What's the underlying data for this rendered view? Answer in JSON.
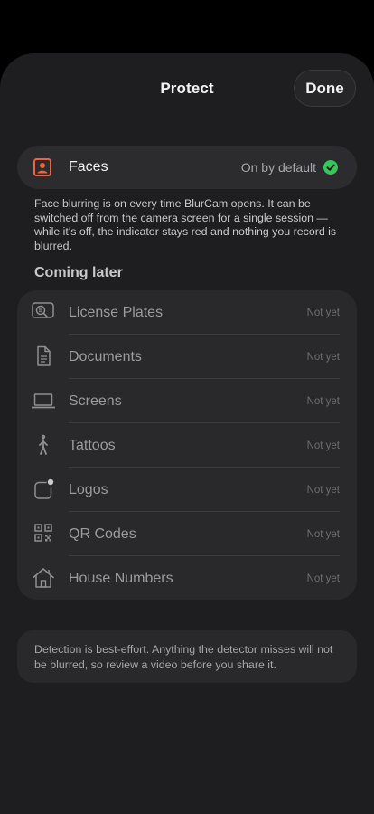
{
  "nav": {
    "title": "Protect",
    "done_label": "Done"
  },
  "faces": {
    "label": "Faces",
    "status": "On by default",
    "description": "Face blurring is on every time BlurCam opens. It can be switched off from the camera screen for a single session — while it's off, the indicator stays red and nothing you record is blurred."
  },
  "coming_later": {
    "heading": "Coming later",
    "items": [
      {
        "label": "License Plates",
        "status": "Not yet",
        "icon": "license-plate-icon"
      },
      {
        "label": "Documents",
        "status": "Not yet",
        "icon": "document-icon"
      },
      {
        "label": "Screens",
        "status": "Not yet",
        "icon": "laptop-icon"
      },
      {
        "label": "Tattoos",
        "status": "Not yet",
        "icon": "person-icon"
      },
      {
        "label": "Logos",
        "status": "Not yet",
        "icon": "app-badge-icon"
      },
      {
        "label": "QR Codes",
        "status": "Not yet",
        "icon": "qr-code-icon"
      },
      {
        "label": "House Numbers",
        "status": "Not yet",
        "icon": "house-icon"
      }
    ]
  },
  "note": {
    "text": "Detection is best-effort. Anything the detector misses will not be blurred, so review a video before you share it."
  },
  "colors": {
    "accent_face": "#f0623c",
    "check_green": "#34c759",
    "sheet_background": "#1e1e20",
    "card_background": "#2c2c2e"
  }
}
